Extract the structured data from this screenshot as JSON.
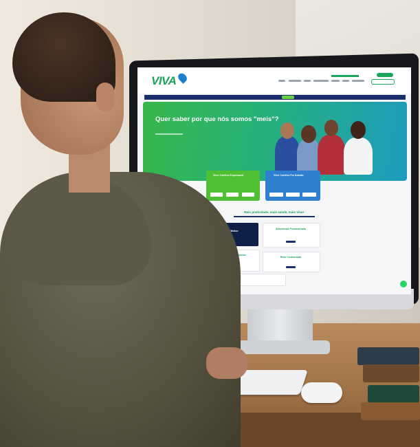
{
  "website": {
    "logo": "VIVA",
    "hero_title": "Quer saber por que nós somos \"meis\"?",
    "plan_cards": [
      {
        "title": "Viver Coletivo Empresarial",
        "color": "#4fc033"
      },
      {
        "title": "Viver Coletivo Por Adesão",
        "color": "#2f7fd0"
      }
    ],
    "section_title": "Mais praticidade, mais saúde, mais Viva+",
    "tiles": [
      {
        "title": "Guia Médico"
      },
      {
        "title": "Assistência Personalizada"
      },
      {
        "title": "Solicitação de Reembolso"
      },
      {
        "title": "Rede Credenciada"
      }
    ]
  },
  "colors": {
    "brand_green": "#1aa35a",
    "navy": "#1a2e6b",
    "hero_start": "#38b74a",
    "hero_end": "#1e9cc0"
  }
}
